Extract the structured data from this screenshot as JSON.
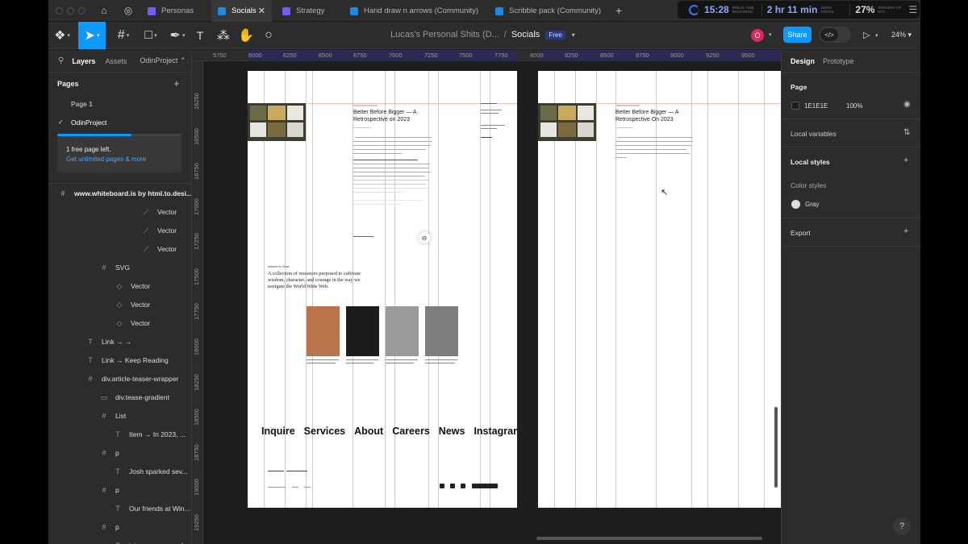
{
  "tabs": [
    {
      "label": "Personas",
      "color": "#7a5af8"
    },
    {
      "label": "Socials",
      "color": "#1e88e5"
    },
    {
      "label": "Strategy",
      "color": "#7a5af8"
    },
    {
      "label": "Hand draw n arrows (Community)",
      "color": "#1e88e5"
    },
    {
      "label": "Scribble pack (Community)",
      "color": "#1e88e5"
    }
  ],
  "timer": {
    "time": "15:28",
    "time_sub": "BREAK TIME REMAINING",
    "hours": "2 hr 11 min",
    "hours_sub": "WORK HOURS",
    "percent": "27%",
    "percent_sub": "PERCENT OF DAY"
  },
  "toolbar": {
    "file_name": "Lucas's Personal Shits (D...",
    "page_name": "Socials",
    "plan_badge": "Free",
    "avatar_letter": "O",
    "share_label": "Share",
    "zoom": "24%"
  },
  "left_panel": {
    "tab_layers": "Layers",
    "tab_assets": "Assets",
    "project": "OdinProject",
    "pages_heading": "Pages",
    "pages": [
      "Page 1",
      "OdinProject"
    ],
    "upsell_line1": "1 free page left.",
    "upsell_line2": "Get unlimited pages & more",
    "upsell_progress": 0.6,
    "layers": [
      {
        "label": "www.whiteboard.is by html.to.desi...",
        "icon": "#"
      },
      {
        "label": "Vector",
        "icon": "vector"
      },
      {
        "label": "Vector",
        "icon": "vector"
      },
      {
        "label": "Vector",
        "icon": "vector"
      },
      {
        "label": "SVG",
        "icon": "#"
      },
      {
        "label": "Vector",
        "icon": "diamond"
      },
      {
        "label": "Vector",
        "icon": "diamond"
      },
      {
        "label": "Vector",
        "icon": "diamond"
      },
      {
        "label": "Link → →",
        "icon": "T"
      },
      {
        "label": "Link → Keep Reading",
        "icon": "T"
      },
      {
        "label": "div.article-teaser-wrapper",
        "icon": "#"
      },
      {
        "label": "div.tease-gradient",
        "icon": "rect"
      },
      {
        "label": "List",
        "icon": "#"
      },
      {
        "label": "Item → In 2023, ...",
        "icon": "T"
      },
      {
        "label": "p",
        "icon": "#"
      },
      {
        "label": "Josh sparked sev...",
        "icon": "T"
      },
      {
        "label": "p",
        "icon": "#"
      },
      {
        "label": "Our friends at Win...",
        "icon": "T"
      },
      {
        "label": "p",
        "icon": "#"
      },
      {
        "label": "intense season of...",
        "icon": "T"
      }
    ]
  },
  "ruler": {
    "h_ticks": [
      "5750",
      "6000",
      "6250",
      "6500",
      "6750",
      "7000",
      "7250",
      "7500",
      "7750",
      "8000",
      "8250",
      "8500",
      "8750",
      "9000",
      "9250",
      "9500"
    ],
    "v_ticks": [
      "16250",
      "16500",
      "16750",
      "17000",
      "17250",
      "17500",
      "17750",
      "18000",
      "18250",
      "18500",
      "18750",
      "19000",
      "19250"
    ]
  },
  "canvas": {
    "article_title": "Better Before Bigger — A Retrospective on 2023",
    "article_title_2": "Better Before Bigger — A Retrospective On 2023",
    "ifg_label": "Internet for Good",
    "ifg_text": "A collection of resources purposed to cultivate wisdom, character, and courage in the way we navigate the World Wide Web.",
    "footer_nav": [
      "Inquire",
      "Services",
      "About",
      "Careers",
      "News",
      "Instagram"
    ]
  },
  "right_panel": {
    "tab_design": "Design",
    "tab_prototype": "Prototype",
    "page_heading": "Page",
    "page_hex": "1E1E1E",
    "page_opacity": "100%",
    "local_variables": "Local variables",
    "local_styles": "Local styles",
    "color_styles": "Color styles",
    "style_gray": "Gray",
    "export": "Export"
  },
  "colors": {
    "accent": "#0d99ff",
    "canvas_bg": "#1e1e1e",
    "panel_bg": "#2c2c2c"
  }
}
